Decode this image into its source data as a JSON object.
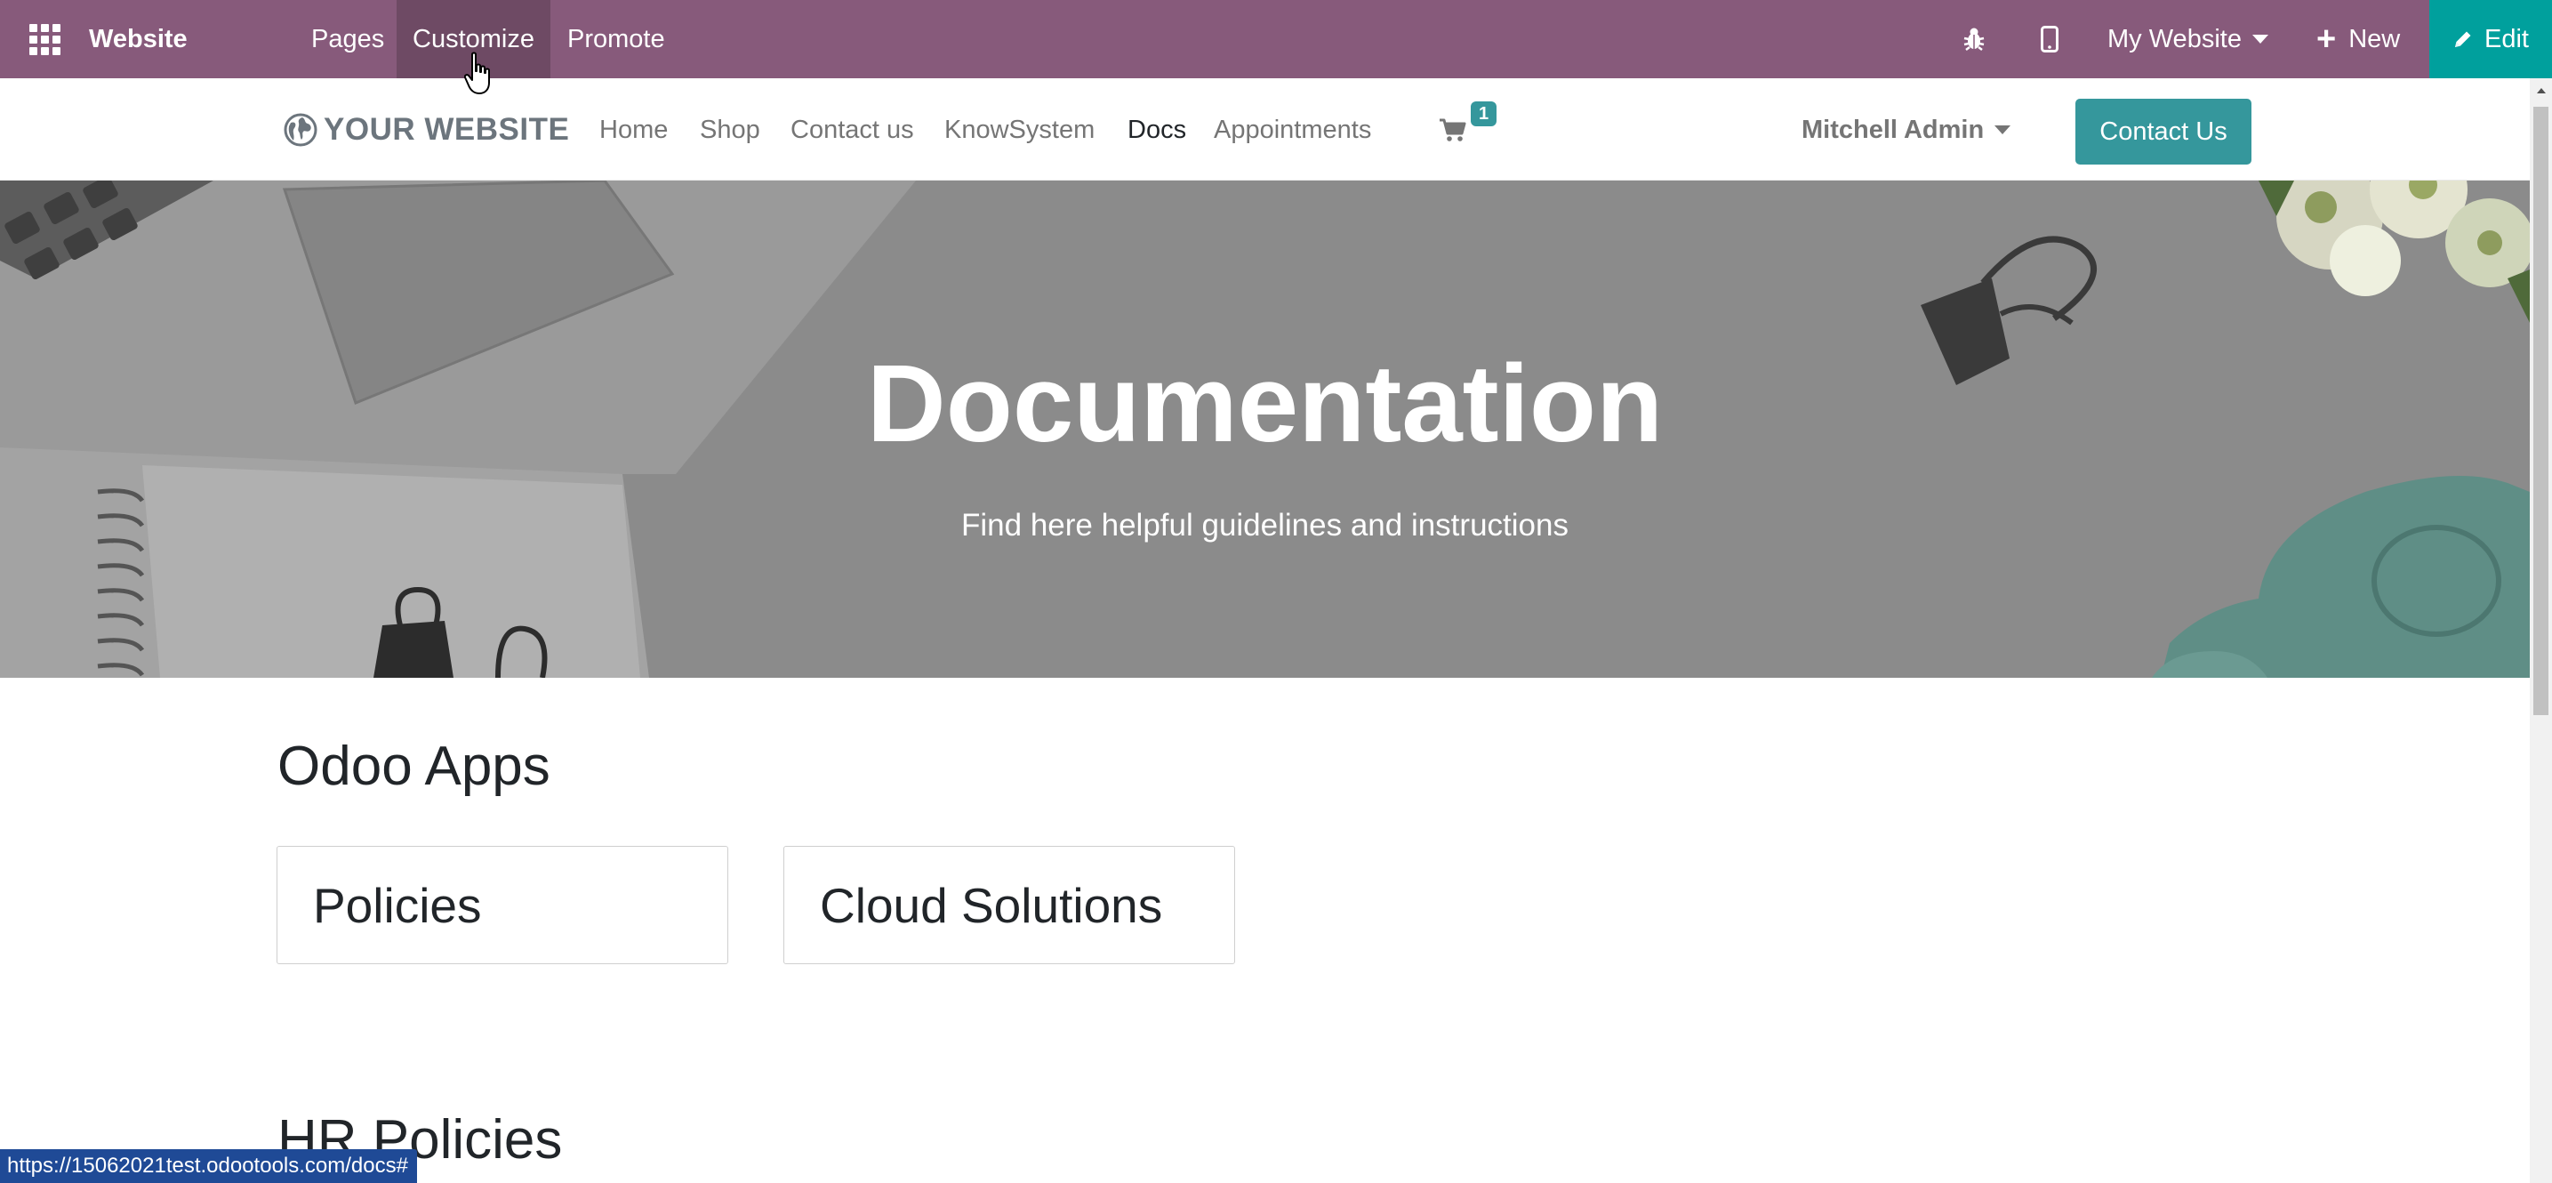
{
  "admin_bar": {
    "brand": "Website",
    "menus": [
      "Pages",
      "Customize",
      "Promote"
    ],
    "website_switcher": "My Website",
    "new_label": "New",
    "edit_label": "Edit",
    "accent_color": "#875a7b",
    "edit_color": "#00a09d"
  },
  "site_nav": {
    "logo_text": "YOUR WEBSITE",
    "links": [
      "Home",
      "Shop",
      "Contact us",
      "KnowSystem",
      "Docs",
      "Appointments"
    ],
    "active_link": "Docs",
    "cart_count": "1",
    "user_name": "Mitchell Admin",
    "contact_button": "Contact Us",
    "button_color": "#35979c"
  },
  "hero": {
    "title": "Documentation",
    "subtitle": "Find here helpful guidelines and instructions"
  },
  "sections": [
    {
      "title": "Odoo Apps",
      "cards": [
        "Policies",
        "Cloud Solutions"
      ]
    },
    {
      "title": "HR Policies"
    }
  ],
  "status_bar": {
    "url": "https://15062021test.odootools.com/docs#"
  },
  "icons": {
    "apps": "apps-grid-icon",
    "debug": "bug-icon",
    "mobile": "mobile-phone-icon",
    "plus": "plus-icon",
    "edit": "pencil-icon",
    "cart": "shopping-cart-icon",
    "logo": "globe-icon"
  }
}
